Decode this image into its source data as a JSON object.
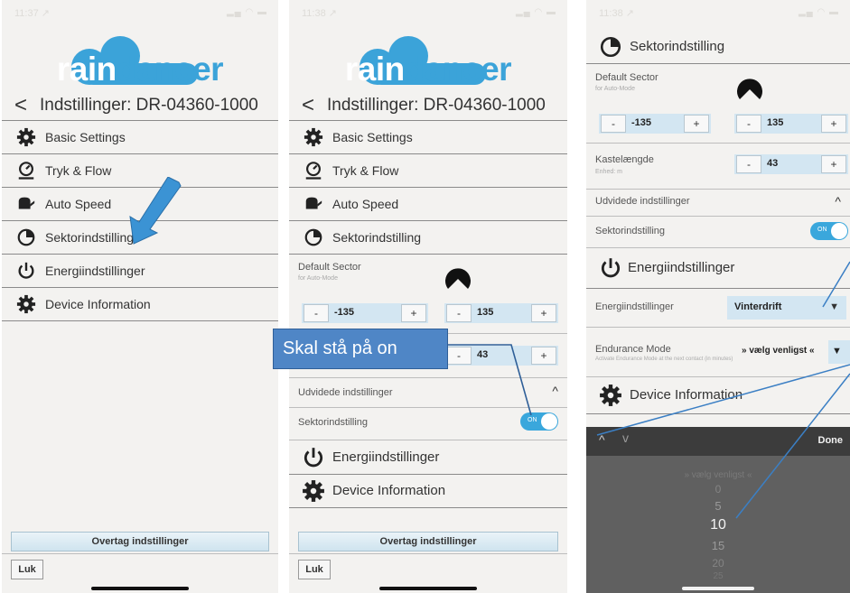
{
  "status": {
    "p1_time": "11:37 ↗",
    "p2_time": "11:38 ↗",
    "p3_time": "11:38 ↗"
  },
  "logo": {
    "part1": "rain",
    "part2": "dancer"
  },
  "header": {
    "back": "<",
    "title": "Indstillinger: DR-04360-1000"
  },
  "menu": {
    "basic": "Basic Settings",
    "tryk": "Tryk & Flow",
    "auto": "Auto Speed",
    "sektor": "Sektorindstilling",
    "energi": "Energiindstillinger",
    "device": "Device Information"
  },
  "sector": {
    "default_label": "Default Sector",
    "default_sub": "for Auto-Mode",
    "minus": "-",
    "plus": "+",
    "left_value": "-135",
    "right_value": "135",
    "kast_label": "Kastelængde",
    "kast_sub": "Enhed: m",
    "kast_value": "43",
    "udvidede": "Udvidede indstillinger",
    "udvidede_chev": "^",
    "toggle_label": "Sektorindstilling",
    "toggle_state": "ON"
  },
  "energi": {
    "label": "Energiindstillinger",
    "value": "Vinterdrift",
    "arrow": "▼",
    "endurance_label": "Endurance Mode",
    "endurance_sub": "Activate Endurance Mode at the next contact (in minutes)",
    "endurance_value": "» vælg venligst «",
    "endurance_arrow": "▼"
  },
  "buttons": {
    "overtag": "Overtag indstillinger",
    "luk": "Luk"
  },
  "callout": "Skal stå på on",
  "picker": {
    "up": "^",
    "down": "v",
    "done": "Done",
    "options": [
      "» vælg venligst «",
      "0",
      "5",
      "10",
      "15",
      "20",
      "25"
    ]
  },
  "colors": {
    "accent": "#3aa7dc",
    "callout": "#4f86c6",
    "arrow": "#3b93d4"
  }
}
